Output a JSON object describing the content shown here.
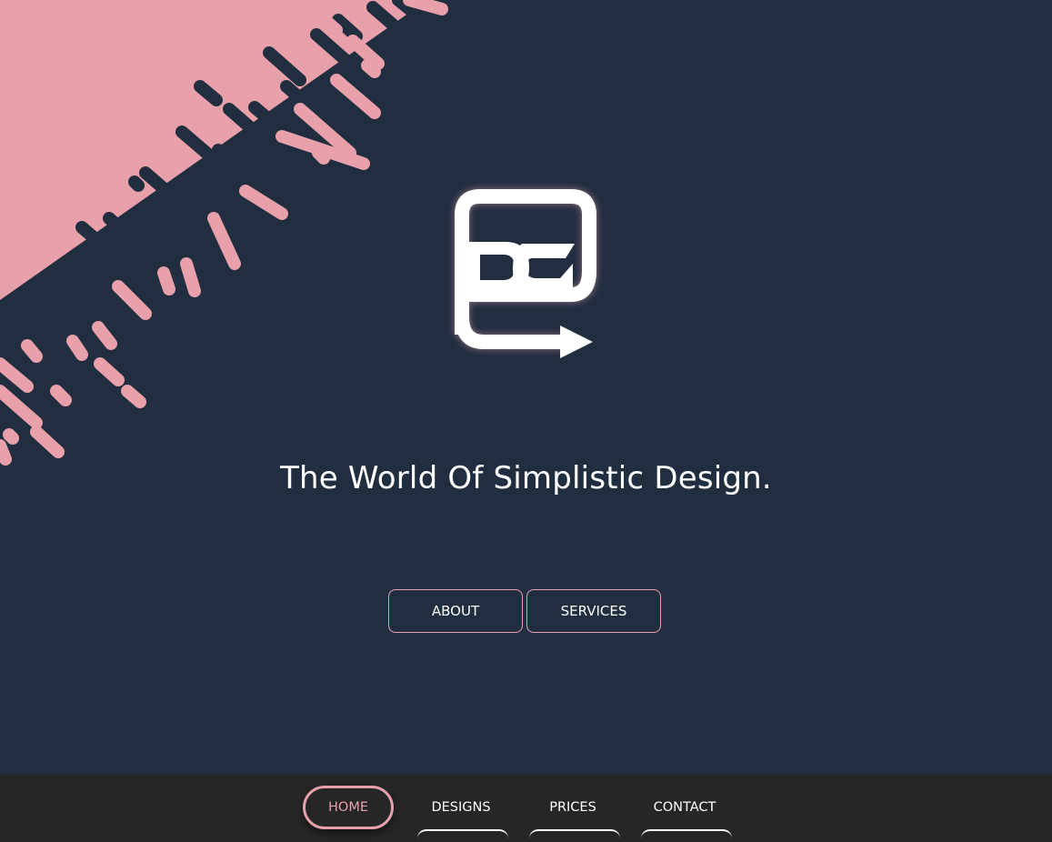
{
  "hero": {
    "tagline": "The World Of Simplistic Design.",
    "logo_icon": "dc-logo-icon",
    "buttons": {
      "about": "ABOUT",
      "services": "SERVICES"
    }
  },
  "nav": {
    "items": [
      {
        "label": "HOME",
        "active": true
      },
      {
        "label": "DESIGNS",
        "active": false
      },
      {
        "label": "PRICES",
        "active": false
      },
      {
        "label": "CONTACT",
        "active": false
      }
    ]
  },
  "colors": {
    "background": "#212e40",
    "accent": "#e8a0aa",
    "navbar": "#262626",
    "text": "#ffffff"
  }
}
